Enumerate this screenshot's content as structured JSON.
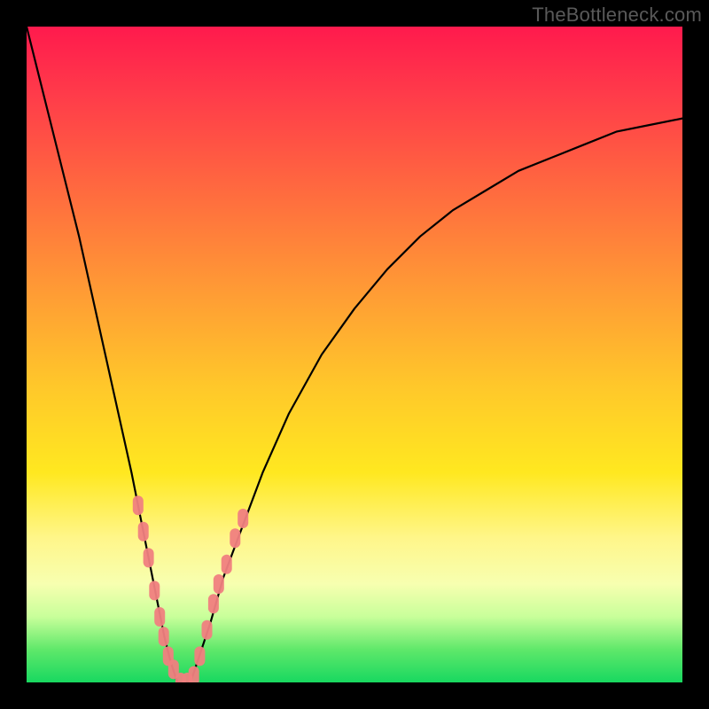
{
  "watermark": "TheBottleneck.com",
  "chart_data": {
    "type": "line",
    "title": "",
    "xlabel": "",
    "ylabel": "",
    "xlim": [
      0,
      100
    ],
    "ylim": [
      0,
      100
    ],
    "grid": false,
    "legend": false,
    "background_gradient": [
      {
        "pos": 0,
        "color": "#ff1a4d"
      },
      {
        "pos": 25,
        "color": "#ff6a3f"
      },
      {
        "pos": 55,
        "color": "#ffc82a"
      },
      {
        "pos": 78,
        "color": "#fff68a"
      },
      {
        "pos": 100,
        "color": "#18d860"
      }
    ],
    "series": [
      {
        "name": "bottleneck-curve",
        "color": "#000000",
        "x": [
          0,
          2,
          4,
          6,
          8,
          10,
          12,
          14,
          16,
          18,
          20,
          21,
          22,
          23,
          24,
          25,
          26,
          28,
          30,
          33,
          36,
          40,
          45,
          50,
          55,
          60,
          65,
          70,
          75,
          80,
          85,
          90,
          95,
          100
        ],
        "y": [
          100,
          92,
          84,
          76,
          68,
          59,
          50,
          41,
          32,
          22,
          12,
          7,
          3,
          0,
          0,
          0,
          3,
          9,
          16,
          24,
          32,
          41,
          50,
          57,
          63,
          68,
          72,
          75,
          78,
          80,
          82,
          84,
          85,
          86
        ]
      }
    ],
    "markers": {
      "name": "highlight-beads",
      "color": "#f08080",
      "shape": "rounded-rect",
      "points": [
        {
          "x": 17.0,
          "y": 27
        },
        {
          "x": 17.8,
          "y": 23
        },
        {
          "x": 18.6,
          "y": 19
        },
        {
          "x": 19.5,
          "y": 14
        },
        {
          "x": 20.3,
          "y": 10
        },
        {
          "x": 20.9,
          "y": 7
        },
        {
          "x": 21.6,
          "y": 4
        },
        {
          "x": 22.4,
          "y": 2
        },
        {
          "x": 23.5,
          "y": 0
        },
        {
          "x": 24.5,
          "y": 0
        },
        {
          "x": 25.5,
          "y": 1
        },
        {
          "x": 26.4,
          "y": 4
        },
        {
          "x": 27.5,
          "y": 8
        },
        {
          "x": 28.5,
          "y": 12
        },
        {
          "x": 29.3,
          "y": 15
        },
        {
          "x": 30.5,
          "y": 18
        },
        {
          "x": 31.8,
          "y": 22
        },
        {
          "x": 33.0,
          "y": 25
        }
      ]
    }
  }
}
